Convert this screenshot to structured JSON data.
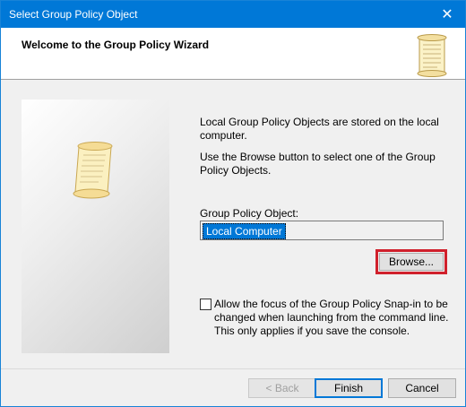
{
  "window": {
    "title": "Select Group Policy Object",
    "close_glyph": "✕"
  },
  "header": {
    "heading": "Welcome to the Group Policy Wizard",
    "icon": "scroll-icon"
  },
  "sidepanel": {
    "icon": "scroll-icon"
  },
  "content": {
    "intro": "Local Group Policy Objects are stored on the local computer.",
    "browse_hint": "Use the Browse button to select one of the Group Policy Objects.",
    "gpo_label": "Group Policy Object:",
    "gpo_value": "Local Computer",
    "browse_label": "Browse...",
    "checkbox_label": "Allow the focus of the Group Policy Snap-in to be changed when launching from the command line.  This only applies if you save the console.",
    "checkbox_checked": false
  },
  "footer": {
    "back_label": "< Back",
    "finish_label": "Finish",
    "cancel_label": "Cancel"
  },
  "colors": {
    "titlebar": "#0078d7",
    "highlight": "#d0202c",
    "selection": "#0078d7"
  }
}
